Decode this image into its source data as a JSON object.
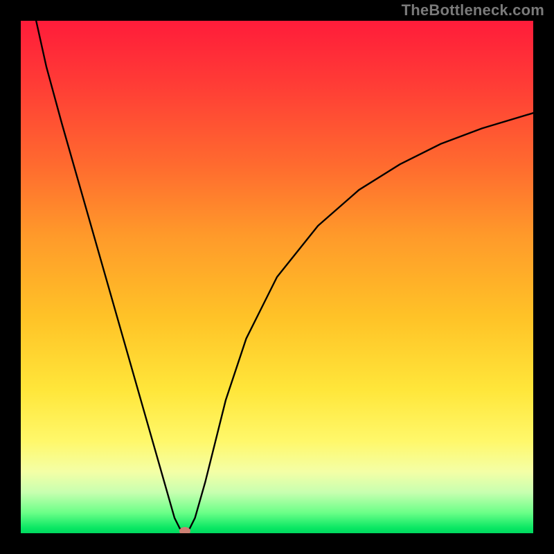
{
  "watermark": "TheBottleneck.com",
  "colors": {
    "frame": "#000000",
    "gradient_top": "#ff1c3a",
    "gradient_mid1": "#ff9a2a",
    "gradient_mid2": "#ffe63a",
    "gradient_bottom": "#00d860",
    "curve": "#000000",
    "marker": "#cd8073"
  },
  "chart_data": {
    "type": "line",
    "title": "",
    "xlabel": "",
    "ylabel": "",
    "x_range": [
      0,
      100
    ],
    "y_range": [
      0,
      100
    ],
    "grid": false,
    "legend": false,
    "series": [
      {
        "name": "bottleneck-curve",
        "x": [
          3,
          5,
          8,
          12,
          16,
          20,
          24,
          26,
          28,
          30,
          31,
          32,
          33,
          34,
          36,
          38,
          40,
          44,
          50,
          58,
          66,
          74,
          82,
          90,
          100
        ],
        "values": [
          100,
          91,
          80,
          66,
          52,
          38,
          24,
          17,
          10,
          3,
          1,
          0,
          1,
          3,
          10,
          18,
          26,
          38,
          50,
          60,
          67,
          72,
          76,
          79,
          82
        ]
      }
    ],
    "marker": {
      "x": 32,
      "y": 0
    },
    "notes": "V-shaped bottleneck curve. Left arm steep and nearly linear from top-left down to minimum near x≈32. Right arm rises with decreasing slope toward upper-right, asymptoting near y≈82. Background is a vertical heat gradient red→green. A small salmon-colored oval marker sits at the curve minimum on the bottom edge."
  }
}
